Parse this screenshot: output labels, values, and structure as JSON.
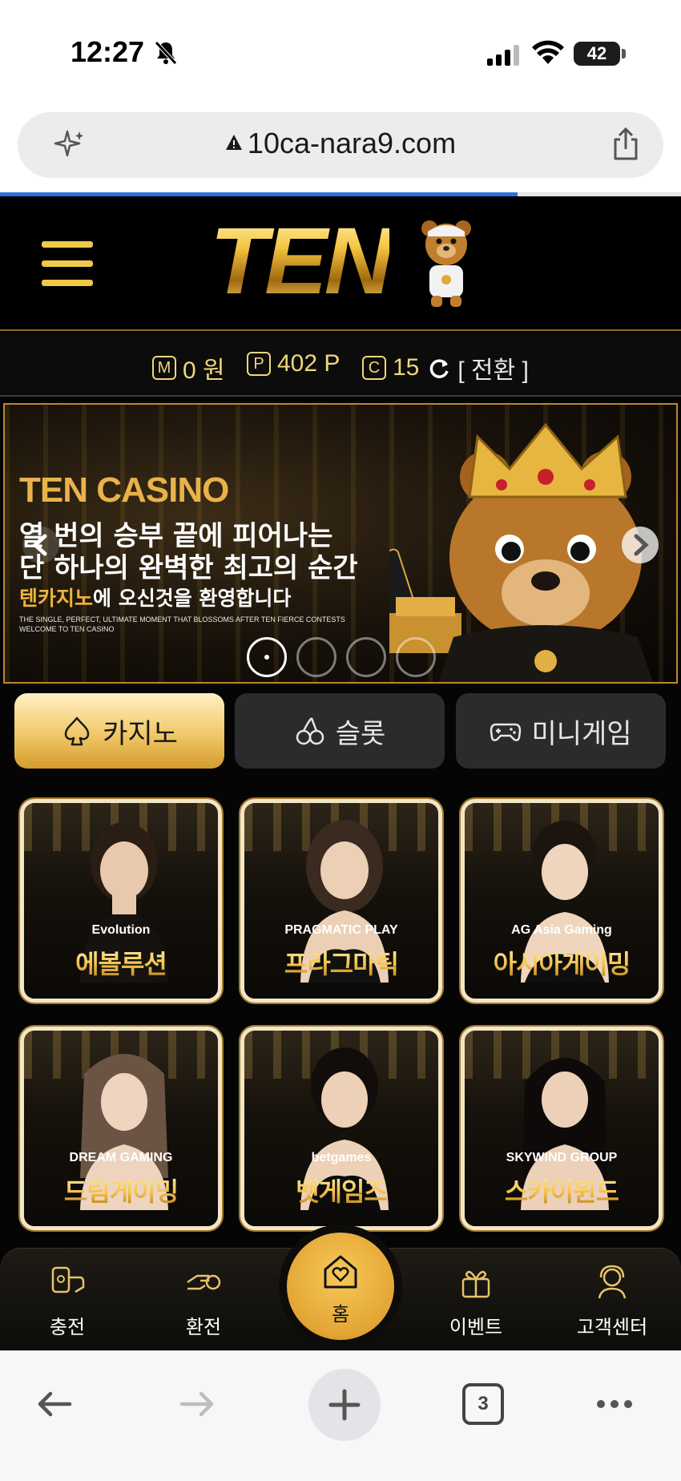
{
  "status_bar": {
    "time": "12:27",
    "battery": "42"
  },
  "browser": {
    "url": "10ca-nara9.com",
    "tabs_count": "3",
    "load_progress": 0.76
  },
  "balance": {
    "money_badge": "M",
    "money_value": "0 원",
    "point_badge": "P",
    "point_value": "402 P",
    "coin_badge": "C",
    "coin_value": "15",
    "convert_label": "[ 전환 ]"
  },
  "banner": {
    "title": "TEN CASINO",
    "line1": "열 번의 승부 끝에 피어나는",
    "line2": "단 하나의 완벽한 최고의 순간",
    "line3_highlight": "텐카지노",
    "line3_rest": "에 오신것을 환영합니다",
    "en_line1": "THE SINGLE, PERFECT, ULTIMATE MOMENT THAT BLOSSOMS AFTER TEN FIERCE CONTESTS",
    "en_line2": "WELCOME TO TEN CASINO",
    "slide_count": 4,
    "active_slide": 1
  },
  "tabs": [
    {
      "label": "카지노",
      "icon": "spade-icon",
      "active": true
    },
    {
      "label": "슬롯",
      "icon": "cherry-icon",
      "active": false
    },
    {
      "label": "미니게임",
      "icon": "gamepad-icon",
      "active": false
    }
  ],
  "games": [
    {
      "provider": "Evolution",
      "name": "에볼루션"
    },
    {
      "provider": "PRAGMATIC PLAY",
      "name": "프라그마틱"
    },
    {
      "provider": "AG Asia Gaming",
      "name": "아시아게이밍"
    },
    {
      "provider": "DREAM GAMING",
      "name": "드림게이밍"
    },
    {
      "provider": "betgames",
      "name": "벳게임즈"
    },
    {
      "provider": "SKYWIND GROUP",
      "name": "스카이윈드"
    }
  ],
  "bottom_nav": {
    "deposit": "충전",
    "withdraw": "환전",
    "home": "홈",
    "event": "이벤트",
    "support": "고객센터"
  },
  "colors": {
    "gold": "#f1c868",
    "accent_blue": "#2e6fde",
    "background": "#050505"
  }
}
